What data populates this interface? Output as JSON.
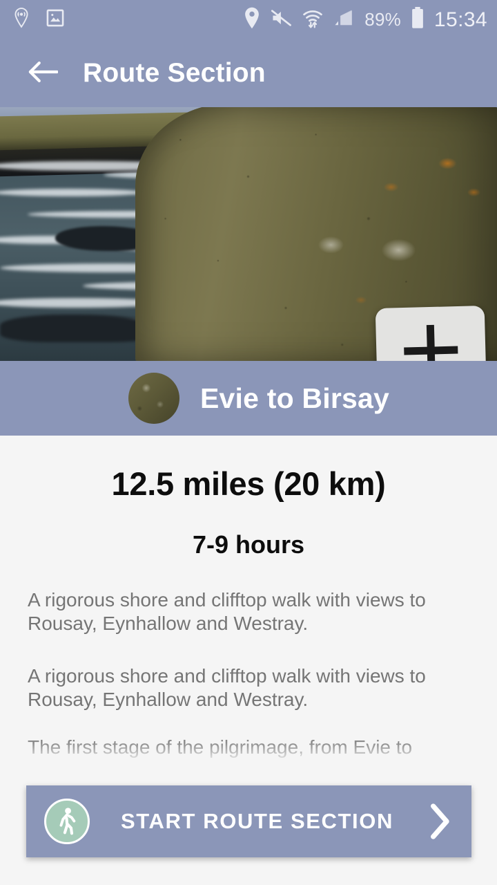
{
  "statusbar": {
    "icons_left": [
      "location-beacon-icon",
      "photo-icon"
    ],
    "icons_right": [
      "location-pin-icon",
      "volume-mute-icon",
      "wifi-transfer-icon",
      "cellular-signal-icon"
    ],
    "battery_percent": "89%",
    "battery_icon": "battery-icon",
    "clock": "15:34"
  },
  "appbar": {
    "back_icon": "back-arrow-icon",
    "title": "Route Section",
    "background_color": "#8b96b8"
  },
  "hero": {
    "alt": "Coastal cliff shore with lichen covered standing stone and pilgrimage waymarker sign",
    "marker_sign_icon": "cross-over-waves-waymarker-icon"
  },
  "section": {
    "thumbnail_icon": "route-thumbnail-avatar",
    "title": "Evie to Birsay"
  },
  "details": {
    "distance": "12.5 miles (20 km)",
    "duration": "7-9 hours",
    "paragraphs": [
      "A rigorous shore and clifftop walk with views to Rousay, Eynhallow and Westray.",
      "A rigorous shore and clifftop walk with views to Rousay, Eynhallow and Westray.",
      "The first stage of the pilgrimage, from Evie to"
    ]
  },
  "cta": {
    "icon": "walking-person-icon",
    "label": "START ROUTE SECTION",
    "chevron_icon": "chevron-right-icon",
    "background_color": "#8b96b8",
    "icon_circle_color": "#a5cbb8"
  }
}
